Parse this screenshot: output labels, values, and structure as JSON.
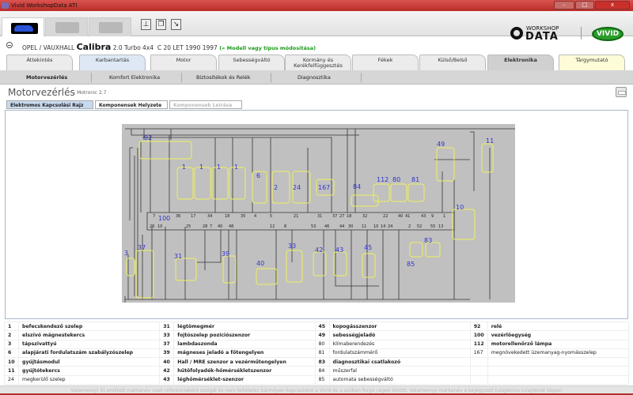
{
  "window": {
    "title": "Vivid WorkshopData ATI",
    "controls": [
      "–",
      "□",
      "x"
    ]
  },
  "toolbar": {
    "tools": [
      "wiring-tool",
      "copy-tool",
      "edit-tool"
    ],
    "logo_workshop": "WORKSHOP",
    "logo_data": "DATA",
    "logo_vivid": "VIVID"
  },
  "vehicle": {
    "make": "OPEL / VAUXHALL",
    "model": "Calibra",
    "variant": "2.0 Turbo 4x4",
    "engine": "C 20 LET 1990 1997",
    "change_link": "(« Modell vagy típus módosítása)"
  },
  "main_tabs": [
    {
      "label": "Áttekintés"
    },
    {
      "label": "Karbantartás"
    },
    {
      "label": "Motor"
    },
    {
      "label": "Sebességváltó"
    },
    {
      "label": "Kormány és Kerékfelfüggesztés"
    },
    {
      "label": "Fékek"
    },
    {
      "label": "Külső/Belső"
    },
    {
      "label": "Elektronika",
      "selected": true
    },
    {
      "label": "Tárgymutató"
    }
  ],
  "sub_nav": [
    {
      "label": "Motorvezérlés",
      "selected": true
    },
    {
      "label": "Komfort Elektronika"
    },
    {
      "label": "Biztosítékok és Relék"
    },
    {
      "label": "Diagnosztika"
    }
  ],
  "page": {
    "title": "Motorvezérlés",
    "subtitle": "- Motronic 2.7"
  },
  "content_tabs": [
    {
      "label": "Elektromos Kapcsolási Rajz",
      "selected": true
    },
    {
      "label": "Komponensek Helyzete"
    },
    {
      "label": "Komponensek Leírása",
      "disabled": true
    }
  ],
  "diagram": {
    "colors": {
      "background": "#c0c0c0",
      "wire": "#333333",
      "highlight": "#f0f060",
      "label": "#3333cc"
    },
    "components": [
      "92",
      "100",
      "1",
      "1",
      "1",
      "1",
      "6",
      "2",
      "24",
      "167",
      "84",
      "112",
      "80",
      "81",
      "49",
      "11",
      "10",
      "3",
      "37",
      "31",
      "39",
      "40",
      "33",
      "42",
      "43",
      "45",
      "85",
      "83"
    ],
    "ecu_pins_top": [
      "7",
      "36",
      "17",
      "34",
      "18",
      "35",
      "4",
      "5",
      "21",
      "31",
      "37",
      "27",
      "18",
      "32",
      "22",
      "40",
      "41",
      "43",
      "9",
      "1"
    ],
    "ecu_pins_bottom": [
      "28",
      "10",
      "25",
      "28",
      "7",
      "40",
      "48",
      "12",
      "8",
      "53",
      "46",
      "44",
      "30",
      "11",
      "10",
      "14",
      "24",
      "2",
      "52",
      "55",
      "13"
    ]
  },
  "legend": [
    [
      {
        "n": "1",
        "t": "befecskendező szelep",
        "b": true
      },
      {
        "n": "31",
        "t": "légtömegmér",
        "b": true
      },
      {
        "n": "45",
        "t": "kopogásszenzor",
        "b": true
      },
      {
        "n": "92",
        "t": "relé",
        "b": true
      }
    ],
    [
      {
        "n": "2",
        "t": "elszívó mágnestekercs",
        "b": true
      },
      {
        "n": "33",
        "t": "fojtószelep pozíciószenzor",
        "b": true
      },
      {
        "n": "49",
        "t": "sebességjeladó",
        "b": true
      },
      {
        "n": "100",
        "t": "vezérlőegység",
        "b": true
      }
    ],
    [
      {
        "n": "3",
        "t": "tápszivattyú",
        "b": true
      },
      {
        "n": "37",
        "t": "lambdaszonda",
        "b": true
      },
      {
        "n": "80",
        "t": "klímaberendezés",
        "b": false
      },
      {
        "n": "112",
        "t": "motorellenőrző lámpa",
        "b": true
      }
    ],
    [
      {
        "n": "6",
        "t": "alapjárati fordulatszám szabályzószelep",
        "b": true
      },
      {
        "n": "39",
        "t": "mágneses jeladó a főtengelyen",
        "b": true
      },
      {
        "n": "81",
        "t": "fordulatszámmérő",
        "b": false
      },
      {
        "n": "167",
        "t": "megnövekedett üzemanyag-nyomásszelep",
        "b": false
      }
    ],
    [
      {
        "n": "10",
        "t": "gyújtásmodul",
        "b": true
      },
      {
        "n": "40",
        "t": "Hall / MRE szenzor a vezérműtengelyen",
        "b": true
      },
      {
        "n": "83",
        "t": "diagnosztikai csatlakozó",
        "b": true
      },
      {
        "n": "",
        "t": "",
        "b": false
      }
    ],
    [
      {
        "n": "11",
        "t": "gyújtótekercs",
        "b": true
      },
      {
        "n": "42",
        "t": "hűtőfolyadék-hőmérsékletszenzor",
        "b": true
      },
      {
        "n": "84",
        "t": "műszerfal",
        "b": false
      },
      {
        "n": "",
        "t": "",
        "b": false
      }
    ],
    [
      {
        "n": "24",
        "t": "megkerülő szelep",
        "b": false
      },
      {
        "n": "43",
        "t": "léghőmérséklet-szenzor",
        "b": true
      },
      {
        "n": "85",
        "t": "automata sebességváltó",
        "b": false
      },
      {
        "n": "",
        "t": "",
        "b": false
      }
    ]
  ],
  "footer": "Valamennyi itt említett márkanév csak referenciaként szolgál és nem feltételez bármilyen kapcsolatot a Vivid és a szóban forgó cégek között. Valamennyi márkanév a bejegyzett tulajdonos tulajdonát képezi"
}
